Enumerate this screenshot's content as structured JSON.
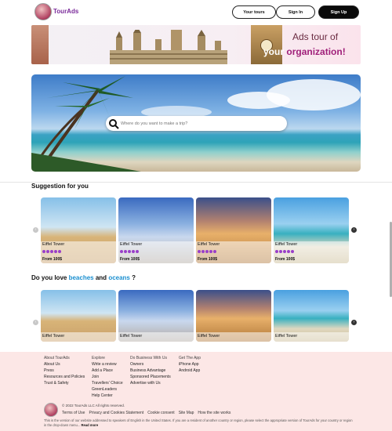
{
  "header": {
    "logo_text": "TourAds",
    "your_tours": "Your tours",
    "sign_in": "Sign In",
    "sign_up": "Sign Up"
  },
  "banner": {
    "line1": "Ads tour of",
    "line2_pre": "your",
    "line2_accent": "organization!"
  },
  "search": {
    "placeholder": "Where do you want to make a trip?"
  },
  "suggestions": {
    "title": "Suggestion for you",
    "cards": [
      {
        "name": "Eiffel Tower",
        "price": "From 100$",
        "rating_dots": 5
      },
      {
        "name": "Eiffel Tower",
        "price": "From 100$",
        "rating_dots": 5
      },
      {
        "name": "Eiffel Tower",
        "price": "From 100$",
        "rating_dots": 5
      },
      {
        "name": "Eiffel Tower",
        "price": "From 100$",
        "rating_dots": 5
      }
    ]
  },
  "beaches": {
    "title_pre": "Do you love",
    "title_beaches": "beaches",
    "title_and": "and",
    "title_oceans": "oceans",
    "title_q": "?",
    "cards": [
      {
        "name": "Eiffel Tower"
      },
      {
        "name": "Eiffel Tower"
      },
      {
        "name": "Eiffel Tower"
      },
      {
        "name": "Eiffel Tower"
      }
    ]
  },
  "footer": {
    "col1": {
      "heading": "About TourAds",
      "items": [
        "About Us",
        "Press",
        "Resources and Policies",
        "Trust & Safety"
      ]
    },
    "col2": {
      "heading": "Explore",
      "items": [
        "Write a review",
        "Add a Place",
        "Join",
        "Travellers' Choice",
        "GreenLeaders",
        "Help Center"
      ]
    },
    "col3": {
      "heading": "Do Business With Us",
      "items": [
        "Owners",
        "Business Advantage",
        "Sponsored Placements",
        "Advertise with Us"
      ]
    },
    "col4": {
      "heading": "Get The App",
      "items": [
        "iPhone App",
        "Android App"
      ]
    },
    "copyright": "© 2022 TourAds LLC All rights reserved.",
    "links": [
      "Terms of Use",
      "Privacy and Cookies Statement",
      "Cookie consent",
      "Site Map",
      "How the site works"
    ],
    "note": "This is the version of our website addressed to speakers of English in the United States. If you are a resident of another country or region, please select the appropriate version of TourAds for your country or region in the drop-down menu...",
    "read_more": "Read more"
  },
  "colors": {
    "accent": "#9a3fc9",
    "link_blue": "#1a8fd0",
    "footer_bg": "#fce7e6",
    "banner_accent": "#a0207a"
  },
  "icons": {
    "search": "search-icon",
    "prev": "chevron-left-icon",
    "next": "chevron-right-icon"
  }
}
